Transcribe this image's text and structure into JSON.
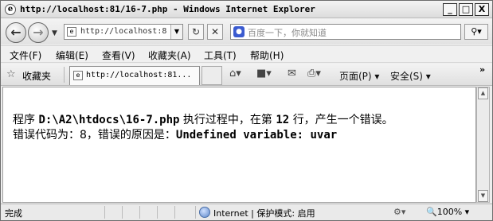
{
  "window": {
    "title": "http://localhost:81/16-7.php - Windows Internet Explorer",
    "minimize": "_",
    "maximize": "□",
    "close": "X"
  },
  "address": {
    "url": "http://localhost:81/16-7.php",
    "search_placeholder": "百度一下，你就知道"
  },
  "menu": [
    "文件(F)",
    "编辑(E)",
    "查看(V)",
    "收藏夹(A)",
    "工具(T)",
    "帮助(H)"
  ],
  "favorites": {
    "label": "收藏夹",
    "tab_title": "http://localhost:81..."
  },
  "commands": {
    "page": "页面(P)",
    "safety": "安全(S)"
  },
  "content": {
    "line1_prefix": "程序",
    "path": "D:\\A2\\htdocs\\16-7.php",
    "line1_middle": "执行过程中，在第",
    "line_number": "12",
    "line1_suffix": "行，产生一个错误。",
    "line2_prefix": "错误代码为：8，错误的原因是：",
    "error_message": "Undefined variable: uvar"
  },
  "status": {
    "text": "完成",
    "zone": "Internet | 保护模式: 启用",
    "zoom": "100%"
  },
  "icons": [
    "ie-page-icon",
    "back-icon",
    "forward-icon",
    "refresh-icon",
    "stop-icon",
    "search-icon",
    "star-icon",
    "home-icon",
    "rss-icon",
    "mail-icon",
    "print-icon",
    "globe-icon"
  ]
}
